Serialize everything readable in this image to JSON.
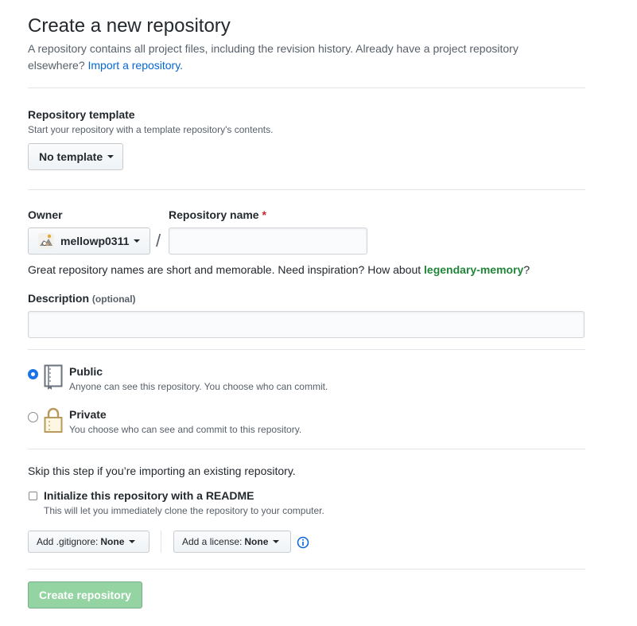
{
  "header": {
    "title": "Create a new repository",
    "subtitle": "A repository contains all project files, including the revision history. Already have a project repository elsewhere?",
    "import_link": "Import a repository."
  },
  "template": {
    "label": "Repository template",
    "note": "Start your repository with a template repository's contents.",
    "button": "No template"
  },
  "owner": {
    "label": "Owner",
    "value": "mellowp0311",
    "avatar_icon": "avatar-icon"
  },
  "separator": "/",
  "repo_name": {
    "label": "Repository name",
    "required_mark": "*",
    "value": "",
    "hint_prefix": "Great repository names are short and memorable. Need inspiration? How about",
    "suggestion": "legendary-memory",
    "hint_suffix": "?"
  },
  "description": {
    "label": "Description",
    "optional": "(optional)",
    "value": ""
  },
  "visibility": {
    "options": [
      {
        "label": "Public",
        "note": "Anyone can see this repository. You choose who can commit.",
        "icon": "repo-book-icon",
        "selected": true
      },
      {
        "label": "Private",
        "note": "You choose who can see and commit to this repository.",
        "icon": "lock-icon",
        "selected": false
      }
    ]
  },
  "init": {
    "skip_note": "Skip this step if you’re importing an existing repository.",
    "readme_label": "Initialize this repository with a README",
    "readme_note": "This will let you immediately clone the repository to your computer.",
    "readme_checked": false,
    "gitignore_label": "Add .gitignore:",
    "gitignore_value": "None",
    "license_label": "Add a license:",
    "license_value": "None",
    "info_icon": "info-icon"
  },
  "submit": {
    "label": "Create repository",
    "disabled": true
  },
  "colors": {
    "link": "#0366d6",
    "required": "#cb2431",
    "suggestion": "#22863a",
    "radio_selected": "#1a73e8",
    "create_disabled": "#94d3a2"
  }
}
